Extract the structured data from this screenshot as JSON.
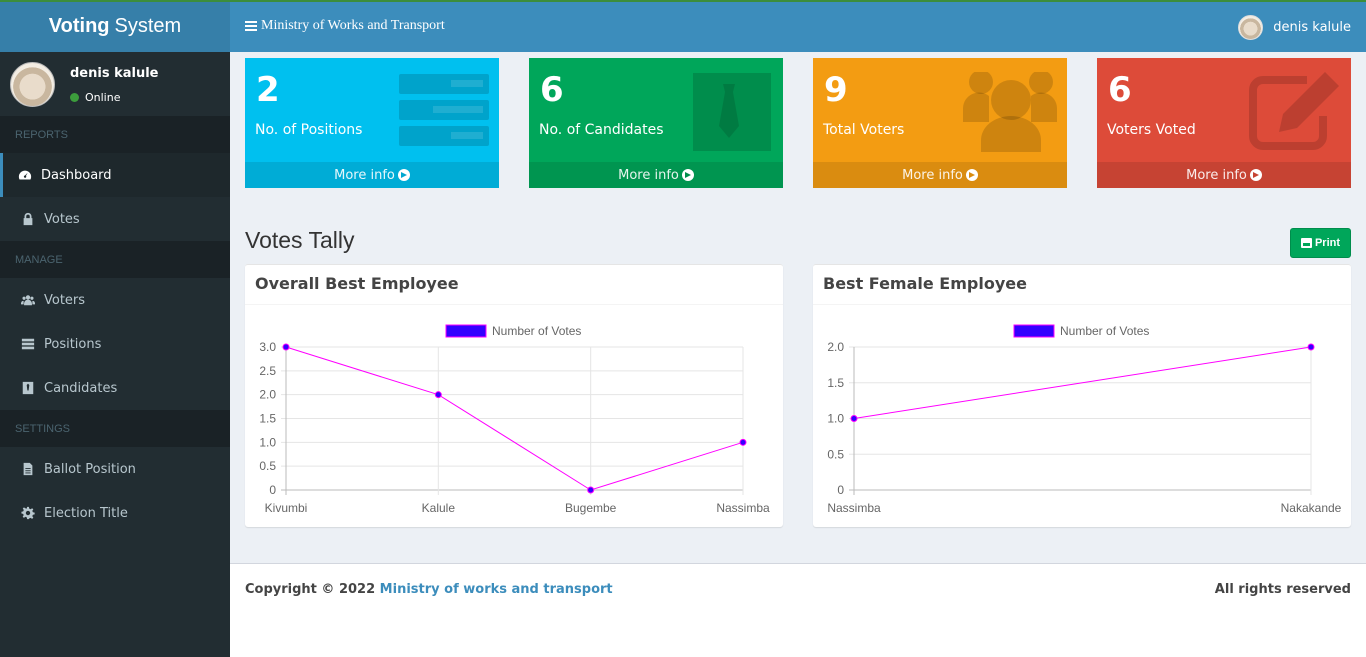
{
  "app": {
    "logo_bold": "Voting",
    "logo_rest": "System"
  },
  "navbar": {
    "title": "Ministry of Works and Transport",
    "user_name": "denis kalule"
  },
  "sidebar": {
    "user_name": "denis kalule",
    "status": "Online",
    "sections": {
      "reports": "REPORTS",
      "manage": "MANAGE",
      "settings": "SETTINGS"
    },
    "items": {
      "dashboard": "Dashboard",
      "votes": "Votes",
      "voters": "Voters",
      "positions": "Positions",
      "candidates": "Candidates",
      "ballot_position": "Ballot Position",
      "election_title": "Election Title"
    }
  },
  "boxes": [
    {
      "value": "2",
      "label": "No. of Positions",
      "more": "More info",
      "color": "#00c0ef",
      "icon": "list-icon"
    },
    {
      "value": "6",
      "label": "No. of Candidates",
      "more": "More info",
      "color": "#00a65a",
      "icon": "tie-icon"
    },
    {
      "value": "9",
      "label": "Total Voters",
      "more": "More info",
      "color": "#f39c12",
      "icon": "users-icon"
    },
    {
      "value": "6",
      "label": "Voters Voted",
      "more": "More info",
      "color": "#dd4b39",
      "icon": "edit-icon"
    }
  ],
  "tally": {
    "title": "Votes Tally",
    "print_label": "Print"
  },
  "chart_data": [
    {
      "type": "line",
      "title": "Overall Best Employee",
      "categories": [
        "Kivumbi",
        "Kalule",
        "Bugembe",
        "Nassimba"
      ],
      "series": [
        {
          "name": "Number of Votes",
          "values": [
            3,
            2,
            0,
            1
          ]
        }
      ],
      "ylim": [
        0,
        3
      ],
      "yticks": [
        "3.0",
        "2.5",
        "2.0",
        "1.5",
        "1.0",
        "0.5",
        "0"
      ],
      "grid": true,
      "legend": "top-center",
      "line_color": "#ff00ff",
      "point_color": "#3300ff"
    },
    {
      "type": "line",
      "title": "Best Female Employee",
      "categories": [
        "Nassimba",
        "Nakakande"
      ],
      "series": [
        {
          "name": "Number of Votes",
          "values": [
            1,
            2
          ]
        }
      ],
      "ylim": [
        0,
        2
      ],
      "yticks": [
        "2.0",
        "1.5",
        "1.0",
        "0.5",
        "0"
      ],
      "grid": true,
      "legend": "top-center",
      "line_color": "#ff00ff",
      "point_color": "#3300ff"
    }
  ],
  "footer": {
    "copyright_prefix": "Copyright © 2022",
    "copyright_link": "Ministry of works and transport",
    "rights": "All rights reserved"
  }
}
